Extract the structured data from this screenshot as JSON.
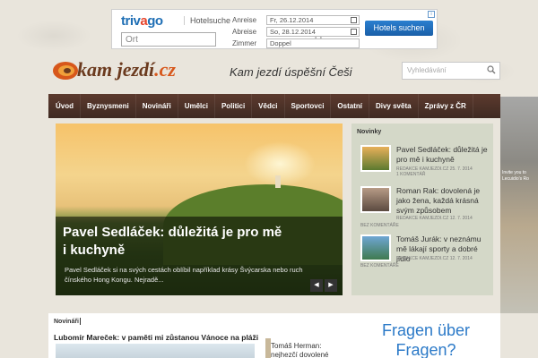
{
  "ad": {
    "brand_pre": "triv",
    "brand_o": "a",
    "brand_post": "go",
    "label": "Hotelsuche",
    "ort_placeholder": "Ort",
    "anreise_label": "Anreise",
    "anreise_value": "Fr, 26.12.2014",
    "abreise_label": "Abreise",
    "abreise_value": "So, 28.12.2014",
    "zimmer_label": "Zimmer",
    "zimmer_value": "Doppel",
    "button": "Hotels suchen"
  },
  "logo": {
    "main": "kam jezdí",
    "suffix": ".cz"
  },
  "tagline": "Kam jezdí úspěšní Češi",
  "search": {
    "placeholder": "Vyhledávání"
  },
  "nav": [
    "Úvod",
    "Byznysmeni",
    "Novináři",
    "Umělci",
    "Politici",
    "Vědci",
    "Sportovci",
    "Ostatní",
    "Divy světa",
    "Zprávy z ČR"
  ],
  "feature": {
    "title": "Pavel Sedláček: důležitá je pro mě i kuchyně",
    "desc": "Pavel Sedláček si na svých cestách oblíbil například krásy Švýcarska nebo ruch čínského Hong Kongu. Nejradě..."
  },
  "novinky": {
    "heading": "Novinky",
    "items": [
      {
        "title": "Pavel Sedláček: důležitá je pro mě i kuchyně",
        "meta": "REDAKCE KAMJEZDI.CZ  25. 7. 2014",
        "comments": "1 KOMENTÁŘ"
      },
      {
        "title": "Roman Rak: dovolená je jako žena, každá krásná svým způsobem",
        "meta": "REDAKCE KAMJEZDI.CZ  12. 7. 2014",
        "comments": "BEZ KOMENTÁŘE"
      },
      {
        "title": "Tomáš Jurák: v neznámu mě lákají sporty a dobré jídlo",
        "meta": "REDAKCE KAMJEZDI.CZ  12. 7. 2014",
        "comments": "BEZ KOMENTÁŘE"
      }
    ]
  },
  "right_ad": {
    "text": "Invite you to Lecuidio's Ro"
  },
  "bottom": {
    "novinari": "Novináři",
    "left_title": "Lubomír Mareček: v paměti mi zůstanou Vánoce na pláži",
    "mid_text": "Tomáš Herman: nejhezčí dovolené jsou ty v České",
    "right_text": "Fragen über Fragen?"
  },
  "colors": {
    "nav_bg": "#4a3128",
    "accent_blue": "#2c7ac8",
    "logo_brown": "#6b3a1e",
    "logo_orange": "#d7571b"
  }
}
